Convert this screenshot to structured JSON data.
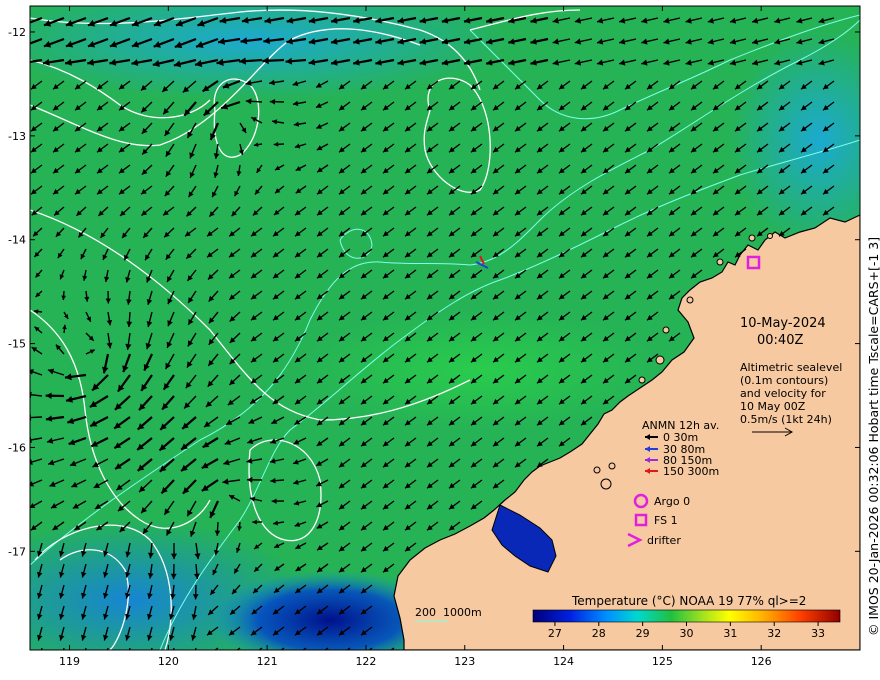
{
  "map": {
    "lon_ticks": [
      "119",
      "120",
      "121",
      "122",
      "123",
      "124",
      "125",
      "126"
    ],
    "lat_ticks": [
      "-12",
      "-13",
      "-14",
      "-15",
      "-16",
      "-17"
    ],
    "lon_range": [
      118.6,
      127.0
    ],
    "lat_range": [
      -17.95,
      -11.75
    ]
  },
  "date_line": "10-May-2024",
  "time_line": "00:40Z",
  "info_lines": [
    "Altimetric sealevel",
    "(0.1m contours)",
    "and velocity for",
    "10 May 00Z",
    "0.5m/s (1kt 24h)"
  ],
  "anmn": {
    "title": "ANMN 12h av.",
    "entries": [
      {
        "label": "0 30m",
        "color": "#000000"
      },
      {
        "label": "30 80m",
        "color": "#1f3fd8"
      },
      {
        "label": "80 150m",
        "color": "#9b2bd8"
      },
      {
        "label": "150 300m",
        "color": "#e01818"
      }
    ]
  },
  "markers": {
    "argo": "Argo 0",
    "fs": "FS 1",
    "drifter": "drifter",
    "color": "#e020e0"
  },
  "depth_label": "200  1000m",
  "colorbar": {
    "title": "Temperature (°C) NOAA 19 77% ql>=2",
    "ticks": [
      "27",
      "28",
      "29",
      "30",
      "31",
      "32",
      "33"
    ],
    "range": [
      26.5,
      33.5
    ]
  },
  "credit": "© IMOS 20-Jan-2026 00:32:06 Hobart time Tscale=CARS+[-1 3]",
  "colors": {
    "land": "#f7c9a0",
    "ocean": "#22b84a",
    "coast": "#000000",
    "contour": "#ffffff",
    "isobath": "#7fffe8"
  }
}
